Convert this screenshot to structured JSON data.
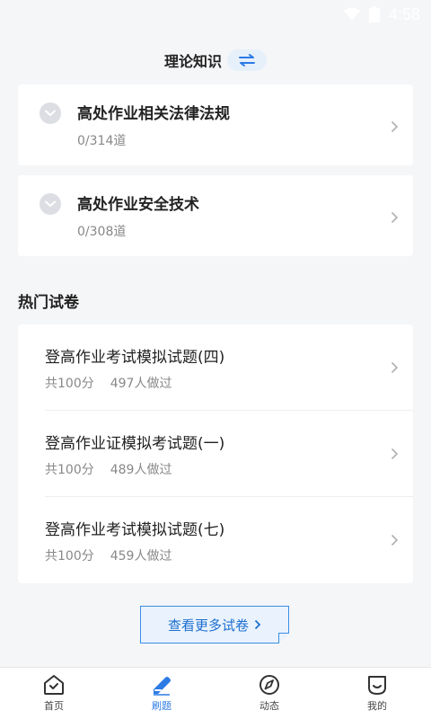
{
  "status_bar": {
    "time": "4:58"
  },
  "header": {
    "title": "理论知识"
  },
  "topics": [
    {
      "title": "高处作业相关法律法规",
      "count": "0/314道"
    },
    {
      "title": "高处作业安全技术",
      "count": "0/308道"
    }
  ],
  "hot_section": {
    "title": "热门试卷"
  },
  "exams": [
    {
      "title": "登高作业考试模拟试题(四)",
      "score": "共100分",
      "takers": "497人做过"
    },
    {
      "title": "登高作业证模拟考试题(一)",
      "score": "共100分",
      "takers": "489人做过"
    },
    {
      "title": "登高作业考试模拟试题(七)",
      "score": "共100分",
      "takers": "459人做过"
    }
  ],
  "more_button": {
    "label": "查看更多试卷"
  },
  "tabbar": {
    "tabs": [
      {
        "label": "首页",
        "icon": "home-icon"
      },
      {
        "label": "刷题",
        "icon": "pencil-icon"
      },
      {
        "label": "动态",
        "icon": "compass-icon"
      },
      {
        "label": "我的",
        "icon": "profile-icon"
      }
    ],
    "active_index": 1
  },
  "colors": {
    "accent": "#2c7be5",
    "background": "#f5f6f8"
  }
}
